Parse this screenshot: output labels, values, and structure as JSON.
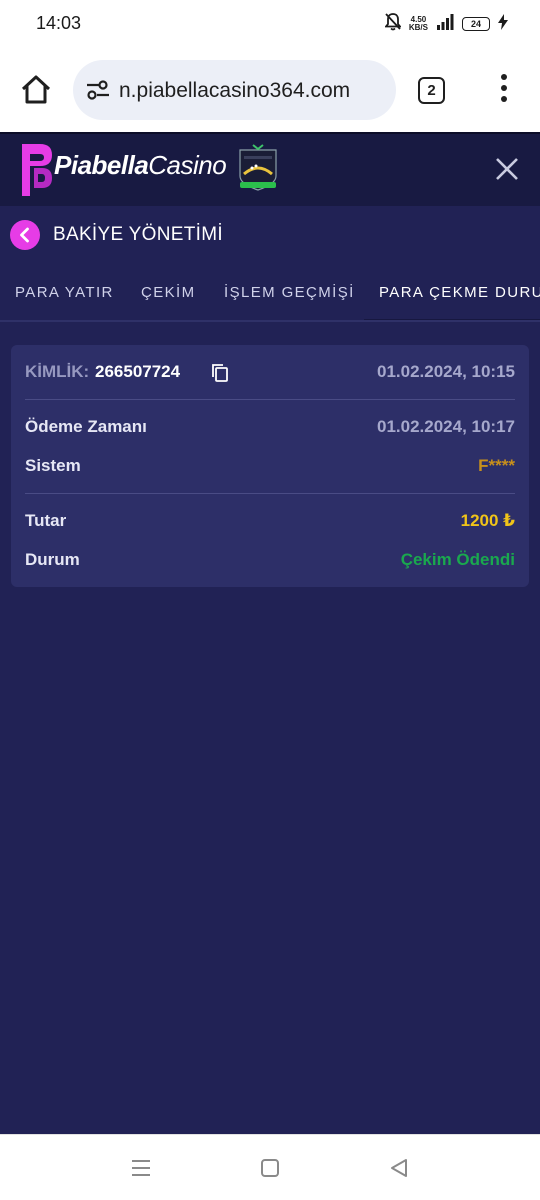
{
  "status_bar": {
    "time": "14:03",
    "net_speed_top": "4.50",
    "net_speed_bottom": "KB/S",
    "battery": "24",
    "icons": [
      "bell-muted-icon",
      "signal-icon",
      "battery-icon",
      "charging-icon"
    ]
  },
  "browser": {
    "url": "n.piabellacasino364.com",
    "tab_count": "2",
    "icons": [
      "home-icon",
      "tune-icon",
      "tabs-icon",
      "more-vert-icon"
    ]
  },
  "site": {
    "brand_bold": "Piabella",
    "brand_regular": "Casino",
    "badge_alt": "curacao-license-badge",
    "colors": {
      "brand": "#e63ce6",
      "header_bg": "#181a42",
      "page_bg": "#212255",
      "card_bg": "#2d2f68"
    }
  },
  "page": {
    "title": "BAKİYE YÖNETİMİ"
  },
  "tabs": [
    {
      "label": "PARA YATIR",
      "active": false
    },
    {
      "label": "ÇEKİM",
      "active": false
    },
    {
      "label": "İŞLEM GEÇMİŞİ",
      "active": false
    },
    {
      "label": "PARA ÇEKME DURUMU",
      "active": true
    }
  ],
  "transaction": {
    "id_label": "KİMLİK:",
    "id_value": "266507724",
    "created_at": "01.02.2024, 10:15",
    "payment_time_label": "Ödeme Zamanı",
    "payment_time_value": "01.02.2024, 10:17",
    "system_label": "Sistem",
    "system_value": "F****",
    "amount_label": "Tutar",
    "amount_value": "1200 ₺",
    "status_label": "Durum",
    "status_value": "Çekim Ödendi",
    "colors": {
      "amount": "#f0c419",
      "status": "#1aa84e",
      "system": "#c8901c"
    }
  },
  "nav_bar": {
    "icons": [
      "recents-icon",
      "home-square-icon",
      "back-triangle-icon"
    ]
  }
}
